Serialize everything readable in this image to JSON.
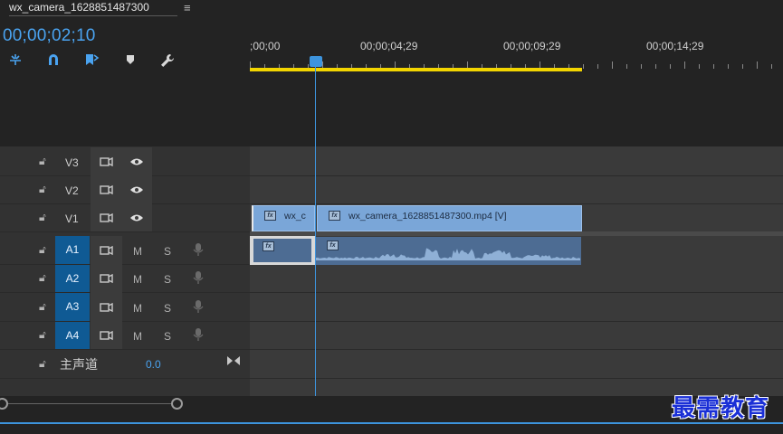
{
  "sequence": {
    "tab_label": "wx_camera_1628851487300",
    "menu_icon": "hamburger-menu-icon"
  },
  "timecode": "00;00;02;10",
  "tools": [
    "snap-icon",
    "linked-selection-icon",
    "add-marker-icon",
    "marker-icon",
    "wrench-icon"
  ],
  "ruler": {
    "labels": [
      ";00;00",
      "00;00;04;29",
      "00;00;09;29",
      "00;00;14;29"
    ]
  },
  "colors": {
    "accent": "#3d94dd",
    "work_area": "#f2d500",
    "video_clip": "#7aa6d8",
    "audio_clip": "#4d6c93",
    "selected_track": "#0f5a94"
  },
  "tracks": {
    "video": [
      {
        "name": "V3"
      },
      {
        "name": "V2"
      },
      {
        "name": "V1"
      }
    ],
    "audio": [
      {
        "name": "A1",
        "mute": "M",
        "solo": "S"
      },
      {
        "name": "A2",
        "mute": "M",
        "solo": "S"
      },
      {
        "name": "A3",
        "mute": "M",
        "solo": "S"
      },
      {
        "name": "A4",
        "mute": "M",
        "solo": "S"
      }
    ],
    "master": {
      "name": "主声道",
      "value": "0.0"
    }
  },
  "clips": {
    "v1_small": {
      "label": "wx_c",
      "fx": "fx"
    },
    "v1_main": {
      "label": "wx_camera_1628851487300.mp4 [V]",
      "fx": "fx"
    },
    "a1_small": {
      "fx": "fx"
    },
    "a1_main": {
      "fx": "fx"
    }
  },
  "watermark": "最需教育"
}
